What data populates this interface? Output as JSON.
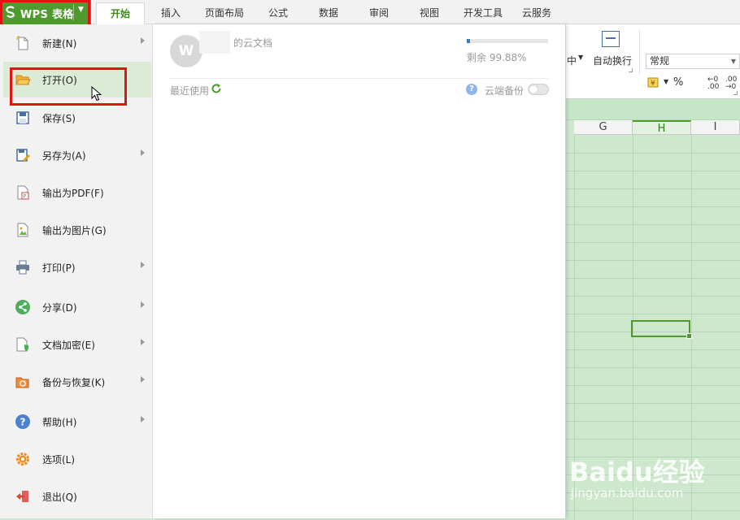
{
  "app": {
    "name": "WPS 表格"
  },
  "tabs": [
    "开始",
    "插入",
    "页面布局",
    "公式",
    "数据",
    "审阅",
    "视图",
    "开发工具",
    "云服务"
  ],
  "ribbon": {
    "align_center_partial": "中",
    "wrap_text": "自动换行",
    "number_format": "常规",
    "percent": "%",
    "dec_increase": "←0 .00",
    "dec_decrease": ".00 →0"
  },
  "grid": {
    "columns": [
      "G",
      "H",
      "I"
    ],
    "selected_column": "H"
  },
  "menu": {
    "items": [
      {
        "label": "新建(N)",
        "icon": "new-file-icon",
        "arrow": true
      },
      {
        "label": "打开(O)",
        "icon": "open-folder-icon",
        "arrow": false,
        "selected": true
      },
      {
        "label": "保存(S)",
        "icon": "save-icon",
        "arrow": false
      },
      {
        "label": "另存为(A)",
        "icon": "save-as-icon",
        "arrow": true
      },
      {
        "label": "输出为PDF(F)",
        "icon": "pdf-icon",
        "arrow": false
      },
      {
        "label": "输出为图片(G)",
        "icon": "image-export-icon",
        "arrow": false
      },
      {
        "label": "打印(P)",
        "icon": "print-icon",
        "arrow": true
      },
      {
        "label": "分享(D)",
        "icon": "share-icon",
        "arrow": true
      },
      {
        "label": "文档加密(E)",
        "icon": "encrypt-icon",
        "arrow": true
      },
      {
        "label": "备份与恢复(K)",
        "icon": "backup-restore-icon",
        "arrow": true
      },
      {
        "label": "帮助(H)",
        "icon": "help-icon",
        "arrow": true
      },
      {
        "label": "选项(L)",
        "icon": "settings-icon",
        "arrow": false
      },
      {
        "label": "退出(Q)",
        "icon": "exit-icon",
        "arrow": false
      }
    ]
  },
  "panel": {
    "cloud_doc": "的云文档",
    "storage_used_fraction": 0.0012,
    "storage_remaining": "剩余 99.88%",
    "recent_label": "最近使用",
    "cloud_backup_label": "云端备份"
  },
  "watermark": {
    "logo": "Baidu经验",
    "url": "jingyan.baidu.com"
  },
  "colors": {
    "brand_green": "#4e9a2c",
    "highlight_red": "#e31313",
    "grid_bg": "#cde8cd",
    "storage_blue": "#3a7bd5"
  }
}
